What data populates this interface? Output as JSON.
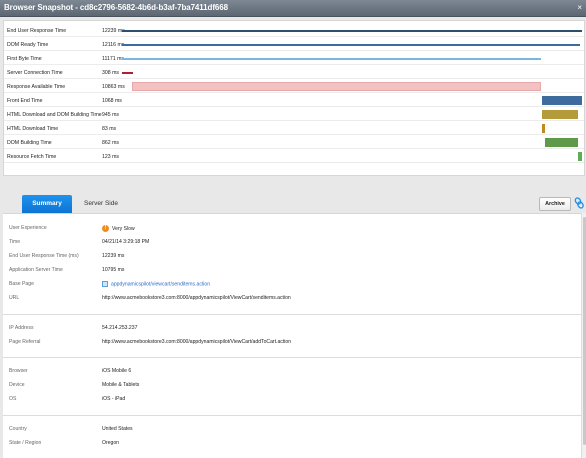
{
  "window": {
    "title": "Browser Snapshot - cd8c2796-5682-4b6d-b3af-7ba7411df668",
    "close_glyph": "×"
  },
  "waterfall": {
    "rows": [
      {
        "label": "End User Response Time",
        "value": "12239 ms",
        "color": "#2d4f6e"
      },
      {
        "label": "DOM Ready Time",
        "value": "12116 ms",
        "color": "#3a6d9e"
      },
      {
        "label": "First Byte Time",
        "value": "11171 ms",
        "color": "#7ab6df"
      },
      {
        "label": "Server Connection Time",
        "value": "308 ms",
        "color": "#b0202a"
      },
      {
        "label": "Response Available Time",
        "value": "10863 ms",
        "color": "#f2c2c2"
      },
      {
        "label": "Front End Time",
        "value": "1068 ms",
        "color": "#3d6b9c"
      },
      {
        "label": "HTML Download and DOM Building Time",
        "value": "945 ms",
        "color": "#b39a3a"
      },
      {
        "label": "HTML Download Time",
        "value": "83 ms",
        "color": "#c08a1e"
      },
      {
        "label": "DOM Building Time",
        "value": "862 ms",
        "color": "#5f9a4a"
      },
      {
        "label": "Resource Fetch Time",
        "value": "123 ms",
        "color": "#5fae55"
      }
    ]
  },
  "tabs": [
    {
      "label": "Summary",
      "active": true
    },
    {
      "label": "Server Side",
      "active": false
    }
  ],
  "toolbar": {
    "archive_label": "Archive",
    "link_icon": "link-icon"
  },
  "details": {
    "user_experience": {
      "label": "User Experience",
      "value": "Very Slow",
      "badge": "!"
    },
    "time": {
      "label": "Time",
      "value": "04/21/14 3:29:18 PM"
    },
    "eurt": {
      "label": "End User Response Time (ms)",
      "value": "12239 ms"
    },
    "app_server_time": {
      "label": "Application Server Time",
      "value": "10795 ms"
    },
    "base_page": {
      "label": "Base Page",
      "value": "appdynamicspilot/viewcart/senditems.action"
    },
    "url": {
      "label": "URL",
      "value": "http://www.acmebookstore3.com:8000/appdynamicspilot/ViewCart/senditems.action"
    },
    "ip_address": {
      "label": "IP Address",
      "value": "54.214.253.237"
    },
    "page_referral": {
      "label": "Page Referral",
      "value": "http://www.acmebookstore3.com:8000/appdynamicspilot/ViewCart/addToCart.action"
    },
    "browser": {
      "label": "Browser",
      "value": "iOS Mobile 6"
    },
    "device": {
      "label": "Device",
      "value": "Mobile & Tablets"
    },
    "os": {
      "label": "OS",
      "value": "iOS - iPad"
    },
    "country": {
      "label": "Country",
      "value": "United States"
    },
    "state": {
      "label": "State / Region",
      "value": "Oregon"
    }
  }
}
